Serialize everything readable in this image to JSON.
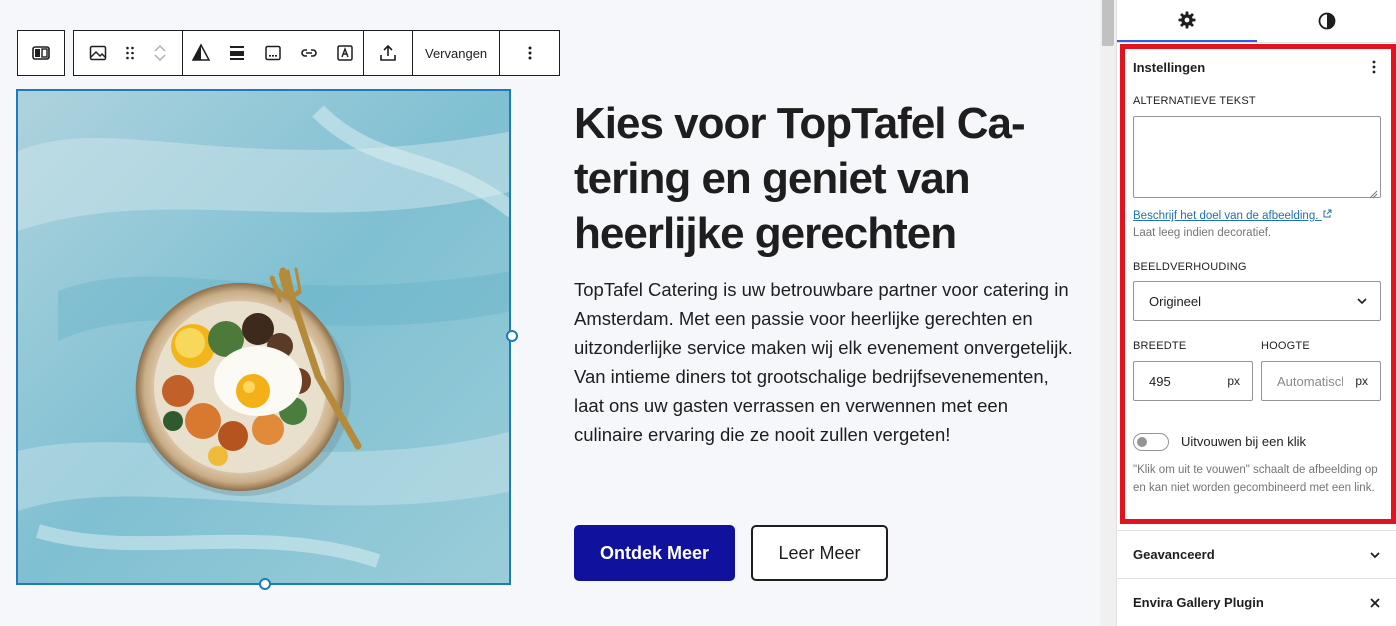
{
  "toolbar": {
    "replace_label": "Vervangen"
  },
  "content": {
    "heading": "Kies voor TopTafel Ca-tering en geniet van heerlijke gerechten",
    "paragraph": "TopTafel Catering is uw betrouwbare partner voor catering in Amsterdam. Met een passie voor heerlijke gerechten en uitzonderlijke service maken wij elk evenement onvergetelijk. Van intieme diners tot grootschalige bedrijfsevenementen, laat ons uw gasten verrassen en verwennen met een culinaire ervaring die ze nooit zullen vergeten!",
    "primary_button": "Ontdek Meer",
    "secondary_button": "Leer Meer"
  },
  "sidebar": {
    "settings": {
      "title": "Instellingen",
      "alt_label": "ALTERNATIEVE TEKST",
      "alt_value": "",
      "alt_link": "Beschrijf het doel van de afbeelding.",
      "alt_help": "Laat leeg indien decoratief.",
      "aspect_label": "BEELDVERHOUDING",
      "aspect_value": "Origineel",
      "width_label": "BREEDTE",
      "width_value": "495",
      "width_unit": "px",
      "height_label": "HOOGTE",
      "height_placeholder": "Automatisch",
      "height_unit": "px",
      "toggle_label": "Uitvouwen bij een klik",
      "toggle_on": false,
      "toggle_help": "\"Klik om uit te vouwen\" schaalt de afbeelding op en kan niet worden gecombineerd met een link."
    },
    "advanced_label": "Geavanceerd",
    "plugin_label": "Envira Gallery Plugin"
  },
  "colors": {
    "primary_button": "#10129e",
    "selection": "#1e7bb8",
    "highlight": "#e0141e",
    "tab_active": "#3858e9"
  }
}
